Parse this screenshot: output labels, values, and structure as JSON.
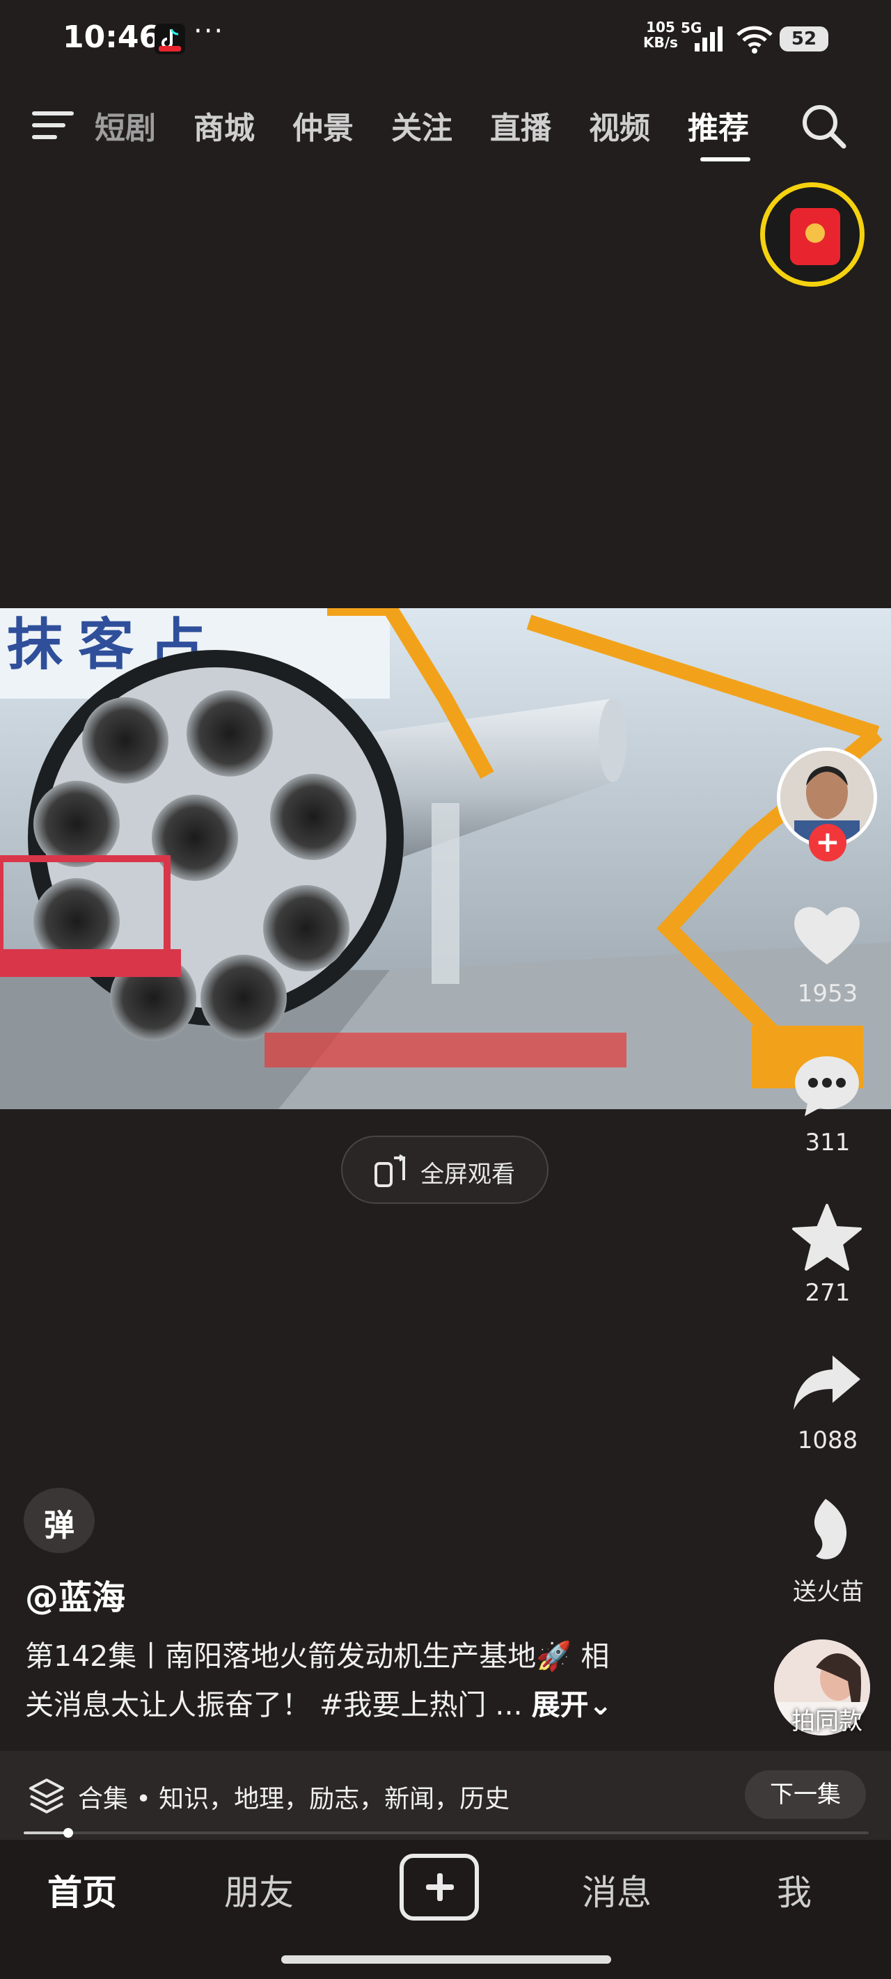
{
  "status_bar": {
    "time": "10:46",
    "more": "···",
    "net_speed_value": "105",
    "net_speed_unit": "KB/s",
    "network": "5G",
    "battery": "52"
  },
  "top_nav": {
    "tabs": [
      {
        "label": "短剧"
      },
      {
        "label": "商城"
      },
      {
        "label": "仲景"
      },
      {
        "label": "关注"
      },
      {
        "label": "直播"
      },
      {
        "label": "视频"
      },
      {
        "label": "推荐",
        "active": true
      }
    ]
  },
  "video": {
    "fullscreen_label": "全屏观看",
    "progress_fraction": 0.053
  },
  "actions": {
    "likes": "1953",
    "comments": "311",
    "favorites": "271",
    "shares": "1088",
    "fire_label": "送火苗",
    "same_style_label": "拍同款"
  },
  "danmaku_label": "弹",
  "post": {
    "author": "@蓝海",
    "caption_line1": "第142集丨南阳落地火箭发动机生产基地🚀 相",
    "caption_line2": "关消息太让人振奋了！ #我要上热门 ... ",
    "expand_label": "展开⌄"
  },
  "collection": {
    "label": "合集 • 知识，地理，励志，新闻，历史",
    "next_label": "下一集"
  },
  "bottom_nav": {
    "home": "首页",
    "friends": "朋友",
    "messages": "消息",
    "me": "我"
  },
  "colors": {
    "background": "#221e1d",
    "accent_red": "#f2373b",
    "ring_yellow": "#f5d20f"
  }
}
